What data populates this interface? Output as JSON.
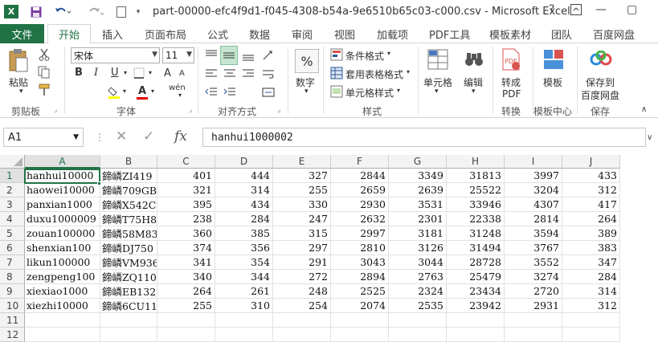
{
  "window": {
    "title": "part-00000-efc4f9d1-f045-4308-b54a-9e6510b65c03-c000.csv - Microsoft Excel",
    "logo": "X",
    "help": "?",
    "minimize": "—",
    "maximize": "▢"
  },
  "tabs": {
    "file": "文件",
    "items": [
      "开始",
      "插入",
      "页面布局",
      "公式",
      "数据",
      "审阅",
      "视图",
      "加载项",
      "PDF工具",
      "模板素材",
      "团队",
      "百度网盘"
    ]
  },
  "ribbon": {
    "paste": "粘贴",
    "clipboard": "剪贴板",
    "font_name": "宋体",
    "font_size": "11",
    "font_group": "字体",
    "bold": "B",
    "italic": "I",
    "underline": "U",
    "font_grow": "A",
    "font_shrink": "A",
    "wen": "wén",
    "align_group": "对齐方式",
    "number": "数字",
    "percent": "%",
    "cond_format": "条件格式",
    "table_format": "套用表格格式",
    "cell_style": "单元格样式",
    "style_group": "样式",
    "cells": "单元格",
    "edit": "编辑",
    "to_pdf_1": "转成",
    "to_pdf_2": "PDF",
    "convert_group": "转换",
    "template": "模板",
    "template_center": "模板中心",
    "save_baidu_1": "保存到",
    "save_baidu_2": "百度网盘",
    "save_group": "保存"
  },
  "formula": {
    "namebox": "A1",
    "fx": "fx",
    "cancel": "✕",
    "confirm": "✓",
    "value": "hanhui1000002"
  },
  "sheet": {
    "columns": [
      "A",
      "B",
      "C",
      "D",
      "E",
      "F",
      "G",
      "H",
      "I",
      "J"
    ],
    "row_numbers": [
      "1",
      "2",
      "3",
      "4",
      "5",
      "6",
      "7",
      "8",
      "9",
      "10",
      "11",
      "12"
    ],
    "rows": [
      [
        "hanhui10000",
        "鍗嶙ZI419",
        "401",
        "444",
        "327",
        "2844",
        "3349",
        "31813",
        "3997",
        "433"
      ],
      [
        "haowei10000",
        "鍗嶙709GB",
        "321",
        "314",
        "255",
        "2659",
        "2639",
        "25522",
        "3204",
        "312"
      ],
      [
        "panxian1000",
        "鍗嶙X542C",
        "395",
        "434",
        "330",
        "2930",
        "3531",
        "33946",
        "4307",
        "417"
      ],
      [
        "duxu1000009",
        "鍗嶙T75H8",
        "238",
        "284",
        "247",
        "2632",
        "2301",
        "22338",
        "2814",
        "264"
      ],
      [
        "zouan100000",
        "鍗嶙58M83",
        "360",
        "385",
        "315",
        "2997",
        "3181",
        "31248",
        "3594",
        "389"
      ],
      [
        "shenxian100",
        "鍗嶙DJ750",
        "374",
        "356",
        "297",
        "2810",
        "3126",
        "31494",
        "3767",
        "383"
      ],
      [
        "likun100000",
        "鍗嶙VM936",
        "341",
        "354",
        "291",
        "3043",
        "3044",
        "28728",
        "3552",
        "347"
      ],
      [
        "zengpeng100",
        "鍗嶙ZQ110",
        "340",
        "344",
        "272",
        "2894",
        "2763",
        "25479",
        "3274",
        "284"
      ],
      [
        "xiexiao1000",
        "鍗嶙EB132",
        "264",
        "261",
        "248",
        "2525",
        "2324",
        "23434",
        "2720",
        "314"
      ],
      [
        "xiezhi10000",
        "鍗嶙6CU11",
        "255",
        "310",
        "254",
        "2074",
        "2535",
        "23942",
        "2931",
        "312"
      ]
    ]
  }
}
